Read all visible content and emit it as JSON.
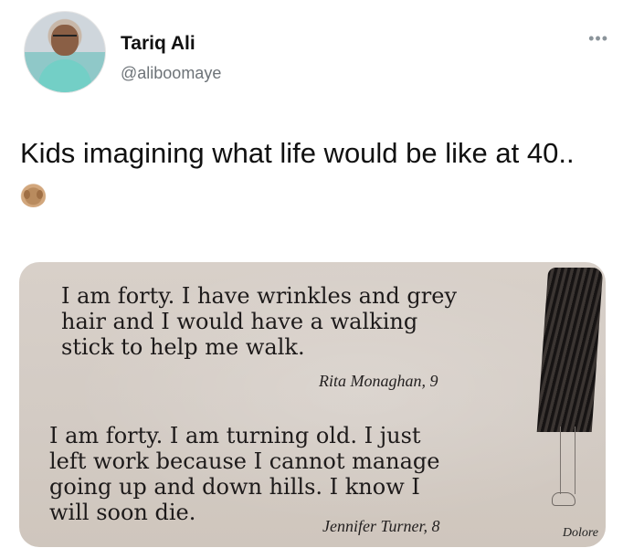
{
  "tweet": {
    "author": {
      "name": "Tariq Ali",
      "handle": "@aliboomaye",
      "avatar_icon": "profile-photo"
    },
    "more_icon": "more-options-icon",
    "text": "Kids imagining what life would be like at 40..",
    "emoji": "see-no-evil-monkey-emoji"
  },
  "image": {
    "quotes": [
      {
        "text": "I am forty. I have wrinkles and grey\nhair and I would have a walking\nstick to help me walk.",
        "author": "Rita Monaghan, 9"
      },
      {
        "text": "I am forty. I am turning old. I just\nleft work because I cannot manage\ngoing up and down hills. I know I\nwill soon die.",
        "author": "Jennifer Turner, 8"
      }
    ],
    "artist_signature": "Dolore"
  },
  "colors": {
    "background": "#ffffff",
    "text": "#111111",
    "muted": "#6d7378",
    "paper": "#d8d0c9"
  }
}
